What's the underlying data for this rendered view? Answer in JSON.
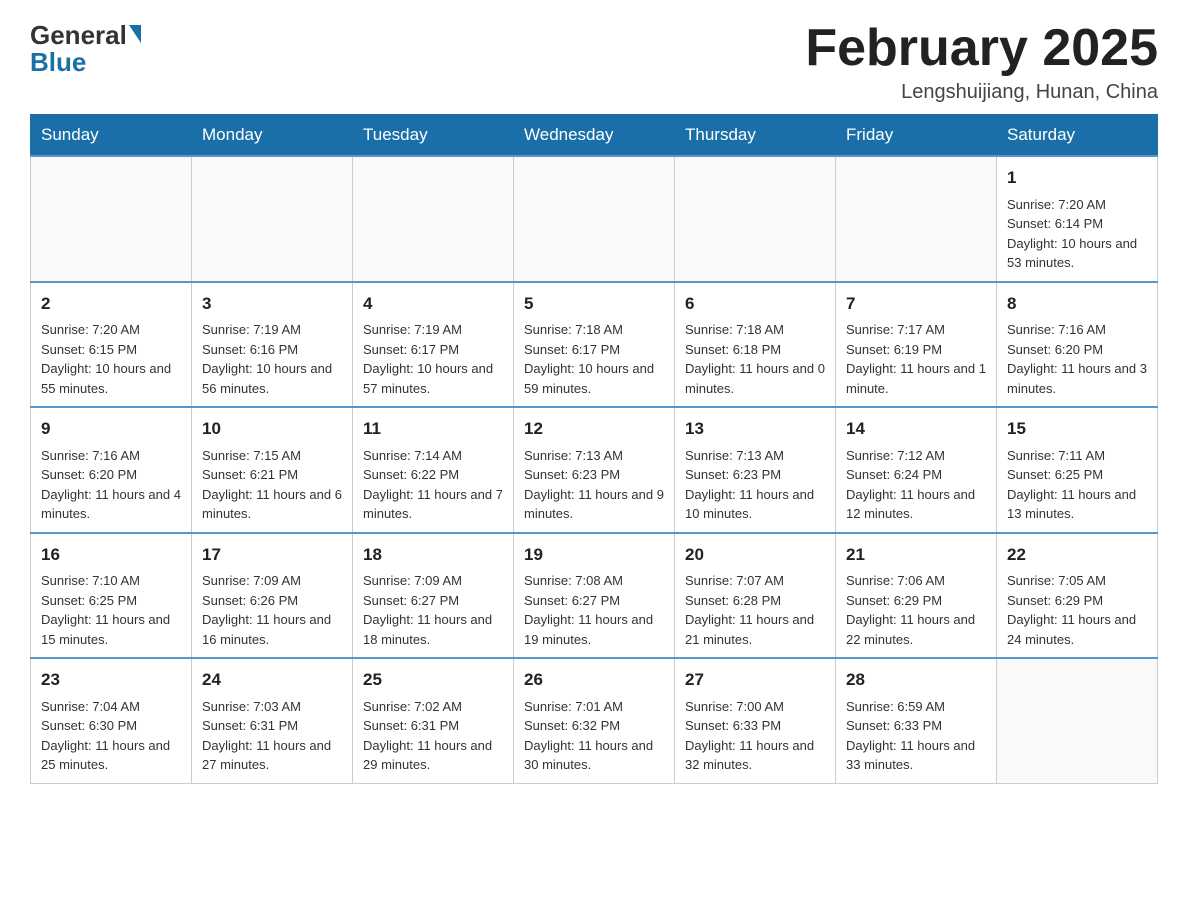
{
  "header": {
    "logo_general": "General",
    "logo_blue": "Blue",
    "month_title": "February 2025",
    "location": "Lengshuijiang, Hunan, China"
  },
  "days_of_week": [
    "Sunday",
    "Monday",
    "Tuesday",
    "Wednesday",
    "Thursday",
    "Friday",
    "Saturday"
  ],
  "weeks": [
    [
      {
        "day": "",
        "sunrise": "",
        "sunset": "",
        "daylight": ""
      },
      {
        "day": "",
        "sunrise": "",
        "sunset": "",
        "daylight": ""
      },
      {
        "day": "",
        "sunrise": "",
        "sunset": "",
        "daylight": ""
      },
      {
        "day": "",
        "sunrise": "",
        "sunset": "",
        "daylight": ""
      },
      {
        "day": "",
        "sunrise": "",
        "sunset": "",
        "daylight": ""
      },
      {
        "day": "",
        "sunrise": "",
        "sunset": "",
        "daylight": ""
      },
      {
        "day": "1",
        "sunrise": "Sunrise: 7:20 AM",
        "sunset": "Sunset: 6:14 PM",
        "daylight": "Daylight: 10 hours and 53 minutes."
      }
    ],
    [
      {
        "day": "2",
        "sunrise": "Sunrise: 7:20 AM",
        "sunset": "Sunset: 6:15 PM",
        "daylight": "Daylight: 10 hours and 55 minutes."
      },
      {
        "day": "3",
        "sunrise": "Sunrise: 7:19 AM",
        "sunset": "Sunset: 6:16 PM",
        "daylight": "Daylight: 10 hours and 56 minutes."
      },
      {
        "day": "4",
        "sunrise": "Sunrise: 7:19 AM",
        "sunset": "Sunset: 6:17 PM",
        "daylight": "Daylight: 10 hours and 57 minutes."
      },
      {
        "day": "5",
        "sunrise": "Sunrise: 7:18 AM",
        "sunset": "Sunset: 6:17 PM",
        "daylight": "Daylight: 10 hours and 59 minutes."
      },
      {
        "day": "6",
        "sunrise": "Sunrise: 7:18 AM",
        "sunset": "Sunset: 6:18 PM",
        "daylight": "Daylight: 11 hours and 0 minutes."
      },
      {
        "day": "7",
        "sunrise": "Sunrise: 7:17 AM",
        "sunset": "Sunset: 6:19 PM",
        "daylight": "Daylight: 11 hours and 1 minute."
      },
      {
        "day": "8",
        "sunrise": "Sunrise: 7:16 AM",
        "sunset": "Sunset: 6:20 PM",
        "daylight": "Daylight: 11 hours and 3 minutes."
      }
    ],
    [
      {
        "day": "9",
        "sunrise": "Sunrise: 7:16 AM",
        "sunset": "Sunset: 6:20 PM",
        "daylight": "Daylight: 11 hours and 4 minutes."
      },
      {
        "day": "10",
        "sunrise": "Sunrise: 7:15 AM",
        "sunset": "Sunset: 6:21 PM",
        "daylight": "Daylight: 11 hours and 6 minutes."
      },
      {
        "day": "11",
        "sunrise": "Sunrise: 7:14 AM",
        "sunset": "Sunset: 6:22 PM",
        "daylight": "Daylight: 11 hours and 7 minutes."
      },
      {
        "day": "12",
        "sunrise": "Sunrise: 7:13 AM",
        "sunset": "Sunset: 6:23 PM",
        "daylight": "Daylight: 11 hours and 9 minutes."
      },
      {
        "day": "13",
        "sunrise": "Sunrise: 7:13 AM",
        "sunset": "Sunset: 6:23 PM",
        "daylight": "Daylight: 11 hours and 10 minutes."
      },
      {
        "day": "14",
        "sunrise": "Sunrise: 7:12 AM",
        "sunset": "Sunset: 6:24 PM",
        "daylight": "Daylight: 11 hours and 12 minutes."
      },
      {
        "day": "15",
        "sunrise": "Sunrise: 7:11 AM",
        "sunset": "Sunset: 6:25 PM",
        "daylight": "Daylight: 11 hours and 13 minutes."
      }
    ],
    [
      {
        "day": "16",
        "sunrise": "Sunrise: 7:10 AM",
        "sunset": "Sunset: 6:25 PM",
        "daylight": "Daylight: 11 hours and 15 minutes."
      },
      {
        "day": "17",
        "sunrise": "Sunrise: 7:09 AM",
        "sunset": "Sunset: 6:26 PM",
        "daylight": "Daylight: 11 hours and 16 minutes."
      },
      {
        "day": "18",
        "sunrise": "Sunrise: 7:09 AM",
        "sunset": "Sunset: 6:27 PM",
        "daylight": "Daylight: 11 hours and 18 minutes."
      },
      {
        "day": "19",
        "sunrise": "Sunrise: 7:08 AM",
        "sunset": "Sunset: 6:27 PM",
        "daylight": "Daylight: 11 hours and 19 minutes."
      },
      {
        "day": "20",
        "sunrise": "Sunrise: 7:07 AM",
        "sunset": "Sunset: 6:28 PM",
        "daylight": "Daylight: 11 hours and 21 minutes."
      },
      {
        "day": "21",
        "sunrise": "Sunrise: 7:06 AM",
        "sunset": "Sunset: 6:29 PM",
        "daylight": "Daylight: 11 hours and 22 minutes."
      },
      {
        "day": "22",
        "sunrise": "Sunrise: 7:05 AM",
        "sunset": "Sunset: 6:29 PM",
        "daylight": "Daylight: 11 hours and 24 minutes."
      }
    ],
    [
      {
        "day": "23",
        "sunrise": "Sunrise: 7:04 AM",
        "sunset": "Sunset: 6:30 PM",
        "daylight": "Daylight: 11 hours and 25 minutes."
      },
      {
        "day": "24",
        "sunrise": "Sunrise: 7:03 AM",
        "sunset": "Sunset: 6:31 PM",
        "daylight": "Daylight: 11 hours and 27 minutes."
      },
      {
        "day": "25",
        "sunrise": "Sunrise: 7:02 AM",
        "sunset": "Sunset: 6:31 PM",
        "daylight": "Daylight: 11 hours and 29 minutes."
      },
      {
        "day": "26",
        "sunrise": "Sunrise: 7:01 AM",
        "sunset": "Sunset: 6:32 PM",
        "daylight": "Daylight: 11 hours and 30 minutes."
      },
      {
        "day": "27",
        "sunrise": "Sunrise: 7:00 AM",
        "sunset": "Sunset: 6:33 PM",
        "daylight": "Daylight: 11 hours and 32 minutes."
      },
      {
        "day": "28",
        "sunrise": "Sunrise: 6:59 AM",
        "sunset": "Sunset: 6:33 PM",
        "daylight": "Daylight: 11 hours and 33 minutes."
      },
      {
        "day": "",
        "sunrise": "",
        "sunset": "",
        "daylight": ""
      }
    ]
  ]
}
